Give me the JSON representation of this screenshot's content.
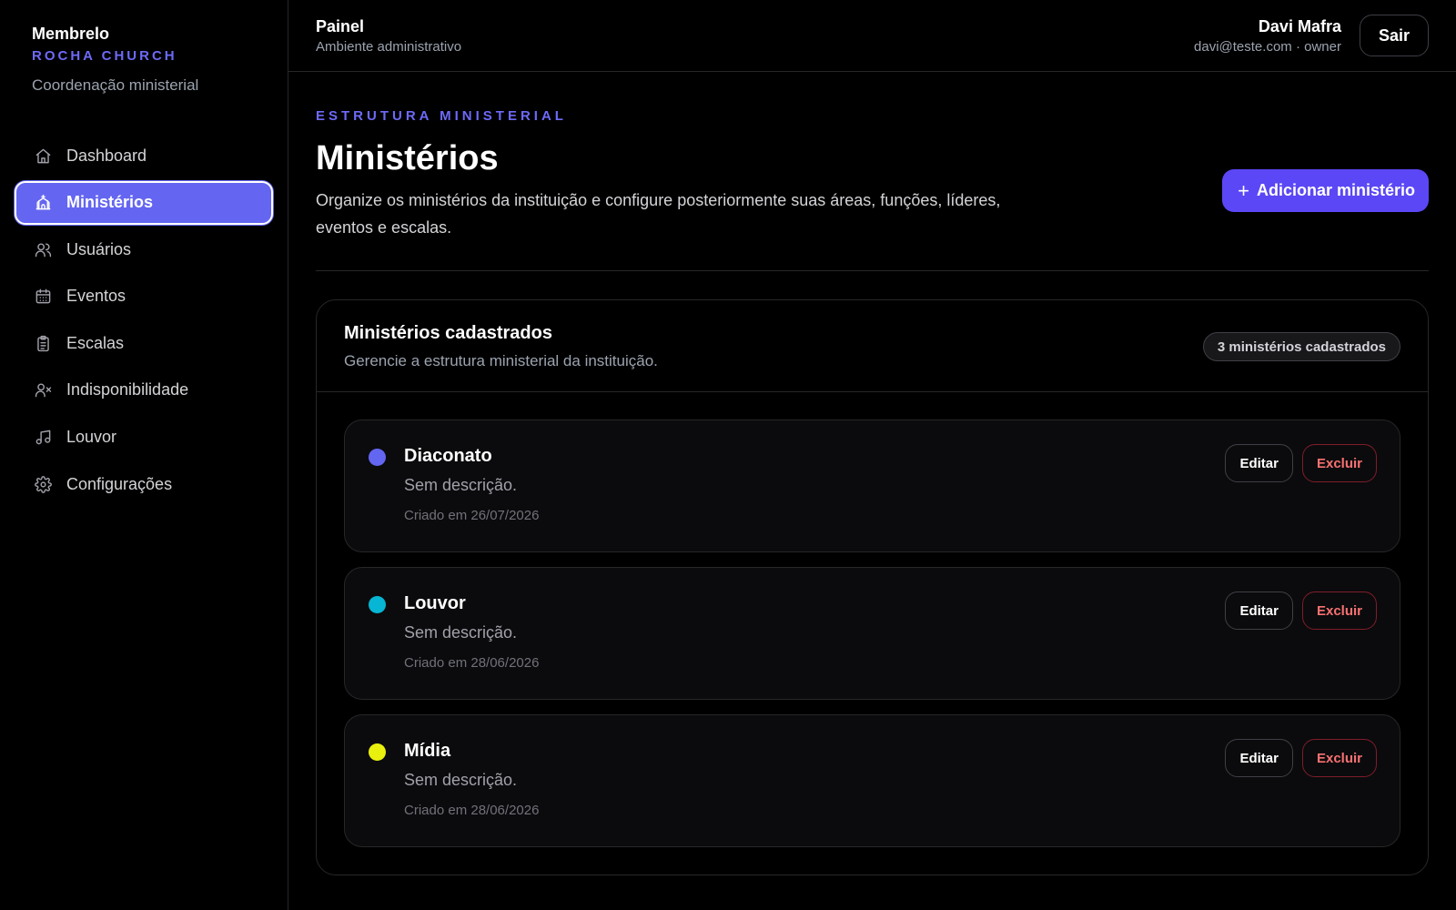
{
  "brand": {
    "name": "Membrelo",
    "church": "ROCHA CHURCH",
    "subtitle": "Coordenação ministerial"
  },
  "sidebar": {
    "items": [
      {
        "label": "Dashboard",
        "icon": "home-icon",
        "active": false
      },
      {
        "label": "Ministérios",
        "icon": "church-icon",
        "active": true
      },
      {
        "label": "Usuários",
        "icon": "users-icon",
        "active": false
      },
      {
        "label": "Eventos",
        "icon": "calendar-icon",
        "active": false
      },
      {
        "label": "Escalas",
        "icon": "clipboard-icon",
        "active": false
      },
      {
        "label": "Indisponibilidade",
        "icon": "user-x-icon",
        "active": false
      },
      {
        "label": "Louvor",
        "icon": "music-icon",
        "active": false
      },
      {
        "label": "Configurações",
        "icon": "gear-icon",
        "active": false
      }
    ]
  },
  "topbar": {
    "title": "Painel",
    "subtitle": "Ambiente administrativo",
    "user_name": "Davi Mafra",
    "user_meta": "davi@teste.com · owner",
    "logout_label": "Sair"
  },
  "page": {
    "eyebrow": "ESTRUTURA MINISTERIAL",
    "title": "Ministérios",
    "description": "Organize os ministérios da instituição e configure posteriormente suas áreas, funções, líderes, eventos e escalas.",
    "add_label": "Adicionar ministério"
  },
  "list": {
    "title": "Ministérios cadastrados",
    "subtitle": "Gerencie a estrutura ministerial da instituição.",
    "count_label": "3 ministérios cadastrados",
    "edit_label": "Editar",
    "delete_label": "Excluir",
    "items": [
      {
        "name": "Diaconato",
        "description": "Sem descrição.",
        "created": "Criado em 26/07/2026",
        "color": "#6366f1"
      },
      {
        "name": "Louvor",
        "description": "Sem descrição.",
        "created": "Criado em 28/06/2026",
        "color": "#06b6d4"
      },
      {
        "name": "Mídia",
        "description": "Sem descrição.",
        "created": "Criado em 28/06/2026",
        "color": "#eaf00e"
      }
    ]
  },
  "colors": {
    "accent": "#6466f1",
    "primary_button": "#5b47f5",
    "danger": "#f87171"
  }
}
